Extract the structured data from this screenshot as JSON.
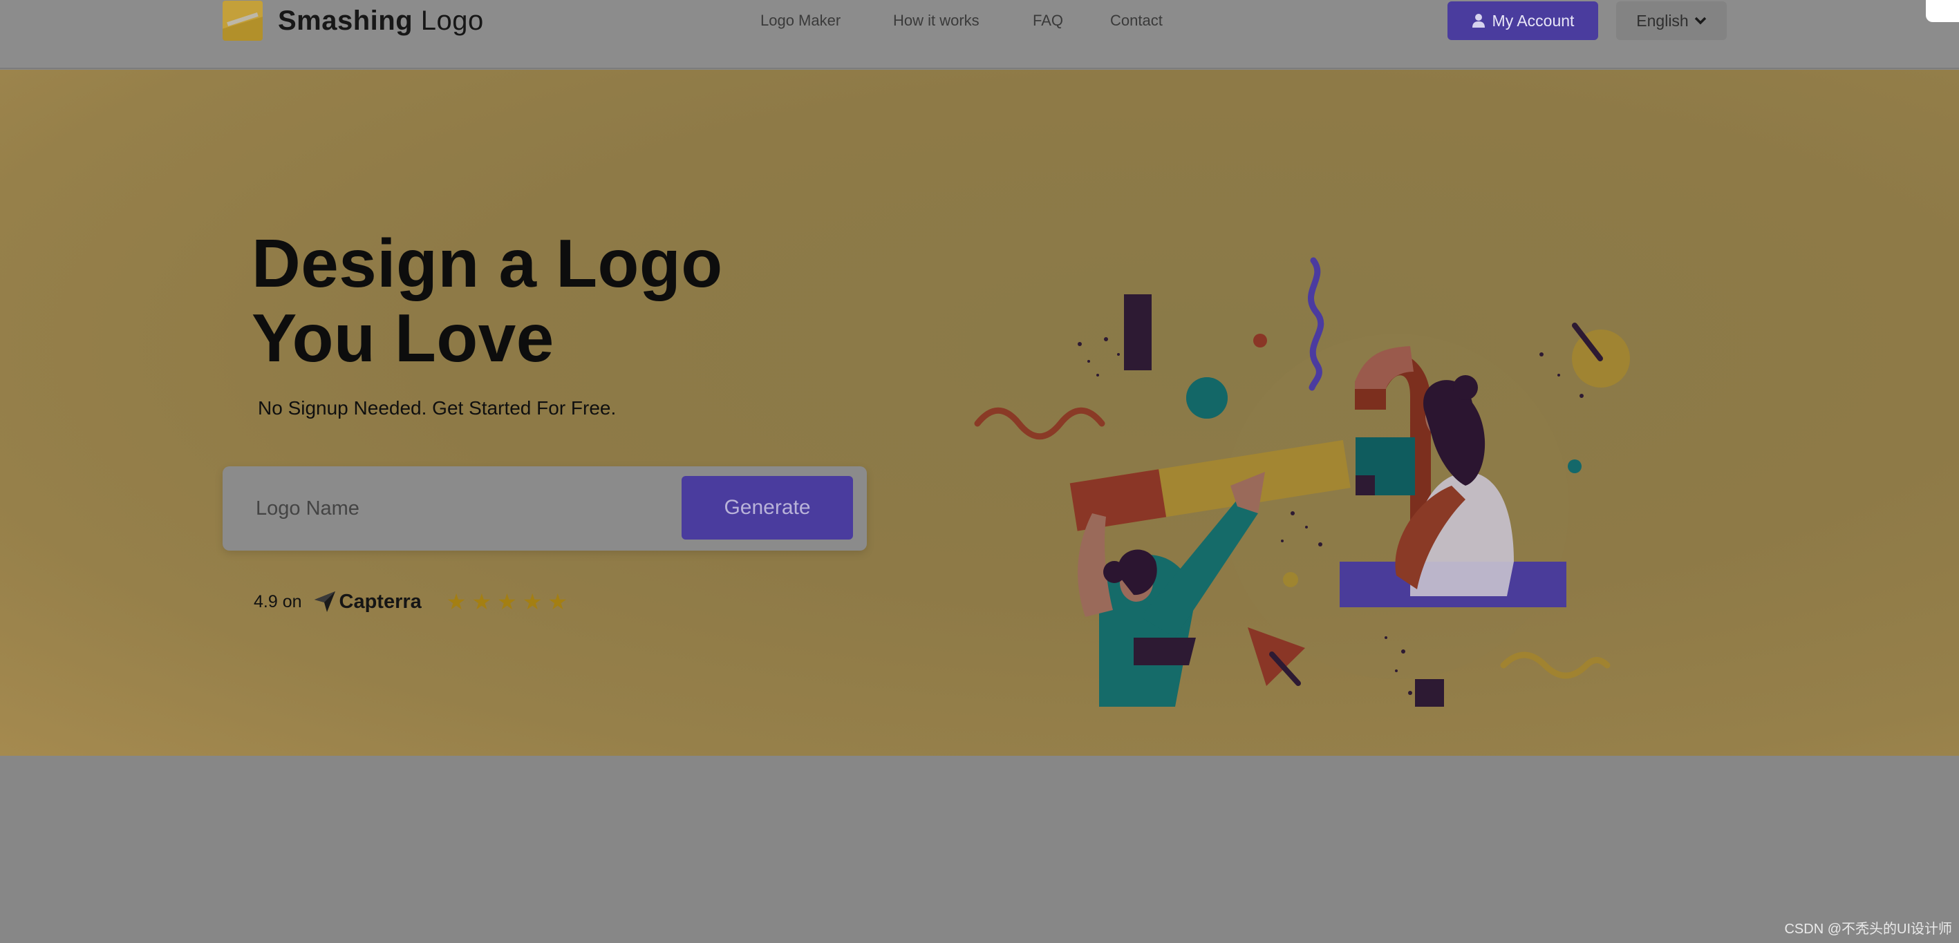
{
  "header": {
    "brand_bold": "Smashing",
    "brand_light": "Logo",
    "nav": [
      "Logo Maker",
      "How it works",
      "FAQ",
      "Contact"
    ],
    "account_label": "My Account",
    "language_label": "English"
  },
  "hero": {
    "title_line1": "Design a Logo",
    "title_line2": "You Love",
    "subtitle": "No Signup Needed. Get Started For Free.",
    "input_placeholder": "Logo Name",
    "generate_label": "Generate",
    "rating_text": "4.9 on",
    "rating_brand": "Capterra",
    "stars": 5
  },
  "footer": {
    "watermark": "CSDN @不秃头的UI设计师"
  },
  "colors": {
    "accent_purple": "#4a3c9e",
    "hero_bg": "#8e7a47",
    "star": "#a47f12"
  },
  "icons": [
    "user-icon",
    "chevron-down-icon",
    "capterra-arrow-icon",
    "star-icon"
  ]
}
